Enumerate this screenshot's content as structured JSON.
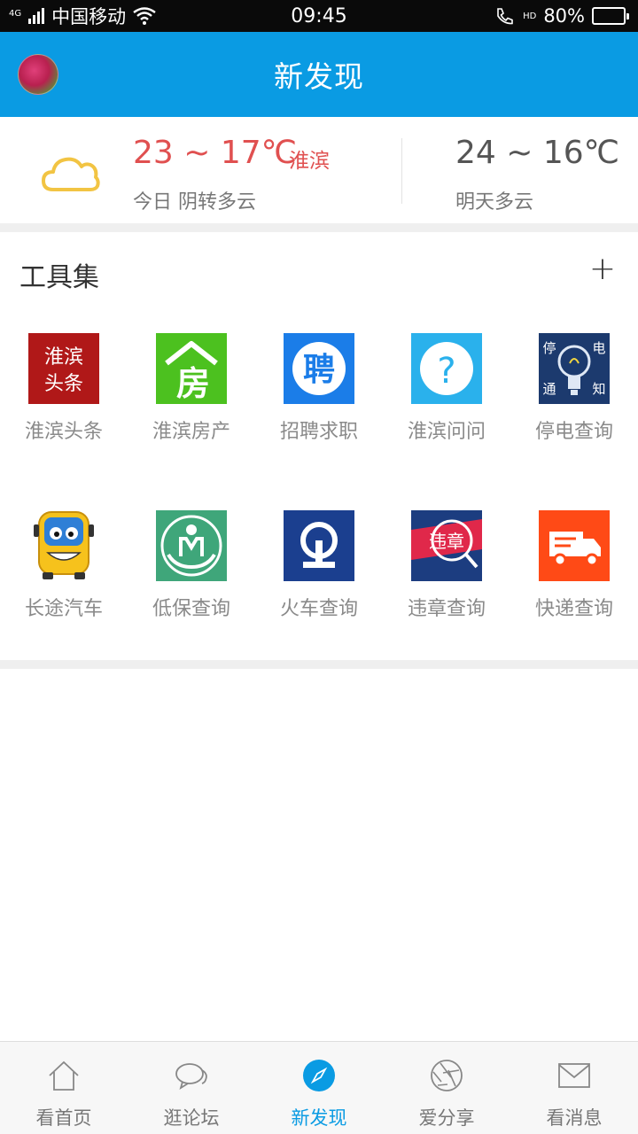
{
  "status_bar": {
    "network_tag": "4G",
    "carrier": "中国移动",
    "time": "09:45",
    "call_tag": "HD",
    "battery": "80%"
  },
  "header": {
    "title": "新发现"
  },
  "weather": {
    "today_temp": "23 ~ 17℃",
    "city": "淮滨",
    "today_desc": "今日 阴转多云",
    "tomorrow_temp": "24 ~ 16℃",
    "tomorrow_desc": "明天多云"
  },
  "tools": {
    "title": "工具集",
    "add_label": "+",
    "items": [
      {
        "label": "淮滨头条",
        "icon_text_1": "淮滨",
        "icon_text_2": "头条"
      },
      {
        "label": "淮滨房产",
        "icon_text": "房"
      },
      {
        "label": "招聘求职",
        "icon_text": "聘"
      },
      {
        "label": "淮滨问问",
        "icon_text": "?"
      },
      {
        "label": "停电查询",
        "icon_text_1": "停",
        "icon_text_2": "电",
        "icon_text_3": "通",
        "icon_text_4": "知"
      },
      {
        "label": "长途汽车"
      },
      {
        "label": "低保查询"
      },
      {
        "label": "火车查询"
      },
      {
        "label": "违章查询",
        "icon_text": "违章"
      },
      {
        "label": "快递查询"
      }
    ]
  },
  "tab_bar": {
    "items": [
      {
        "label": "看首页"
      },
      {
        "label": "逛论坛"
      },
      {
        "label": "新发现"
      },
      {
        "label": "爱分享"
      },
      {
        "label": "看消息"
      }
    ],
    "active_index": 2
  },
  "colors": {
    "brand_blue": "#0a9be3",
    "temp_red": "#e05050"
  }
}
